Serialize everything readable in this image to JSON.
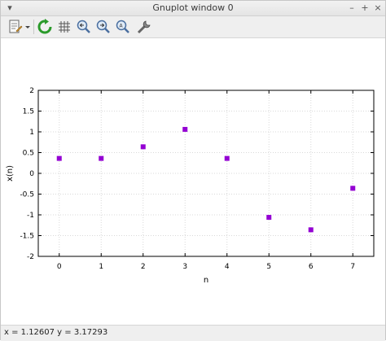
{
  "window": {
    "title": "Gnuplot window 0",
    "controls": [
      "▾",
      "–",
      "+",
      "×"
    ]
  },
  "toolbar": {
    "tools": [
      "copy-to-clipboard-icon",
      "replot-icon",
      "grid-icon",
      "zoom-in-icon",
      "zoom-out-icon",
      "autoscale-icon",
      "options-icon"
    ]
  },
  "status": {
    "text": "x = 1.12607 y = 3.17293"
  },
  "chart_data": {
    "type": "scatter",
    "x": [
      0,
      1,
      2,
      3,
      4,
      5,
      6,
      7
    ],
    "y": [
      0.36,
      0.36,
      0.64,
      1.06,
      0.36,
      -1.06,
      -1.36,
      -0.36
    ],
    "xlabel": "n",
    "ylabel": "x(n)",
    "xlim": [
      -0.5,
      7.5
    ],
    "ylim": [
      -2,
      2
    ],
    "xticks": [
      0,
      1,
      2,
      3,
      4,
      5,
      6,
      7
    ],
    "yticks": [
      -2,
      -1.5,
      -1,
      -0.5,
      0,
      0.5,
      1,
      1.5,
      2
    ],
    "ytick_labels": [
      "-2",
      "-1.5",
      "-1",
      "-0.5",
      "0",
      "0.5",
      "1",
      "1.5",
      "2"
    ],
    "grid": true,
    "marker_color": "#9400d3"
  }
}
